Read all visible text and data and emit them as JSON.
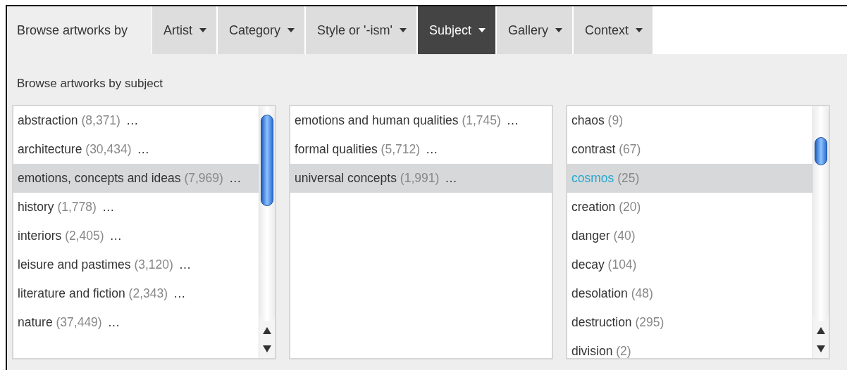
{
  "nav": {
    "label": "Browse artworks by",
    "tabs": [
      {
        "label": "Artist",
        "selected": false
      },
      {
        "label": "Category",
        "selected": false
      },
      {
        "label": "Style or '-ism'",
        "selected": false
      },
      {
        "label": "Subject",
        "selected": true
      },
      {
        "label": "Gallery",
        "selected": false
      },
      {
        "label": "Context",
        "selected": false
      }
    ]
  },
  "heading": "Browse artworks by subject",
  "lists": [
    {
      "items": [
        {
          "name": "abstraction",
          "count": "(8,371)",
          "more": "…",
          "selected": false
        },
        {
          "name": "architecture",
          "count": "(30,434)",
          "more": "…",
          "selected": false
        },
        {
          "name": "emotions, concepts and ideas",
          "count": "(7,969)",
          "more": "…",
          "selected": true
        },
        {
          "name": "history",
          "count": "(1,778)",
          "more": "…",
          "selected": false
        },
        {
          "name": "interiors",
          "count": "(2,405)",
          "more": "…",
          "selected": false
        },
        {
          "name": "leisure and pastimes",
          "count": "(3,120)",
          "more": "…",
          "selected": false
        },
        {
          "name": "literature and fiction",
          "count": "(2,343)",
          "more": "…",
          "selected": false
        },
        {
          "name": "nature",
          "count": "(37,449)",
          "more": "…",
          "selected": false
        }
      ]
    },
    {
      "items": [
        {
          "name": "emotions and human qualities",
          "count": "(1,745)",
          "more": "…",
          "selected": false
        },
        {
          "name": "formal qualities",
          "count": "(5,712)",
          "more": "…",
          "selected": false
        },
        {
          "name": "universal concepts",
          "count": "(1,991)",
          "more": "…",
          "selected": true
        }
      ]
    },
    {
      "items": [
        {
          "name": "chaos",
          "count": "(9)",
          "selected": false,
          "current": false
        },
        {
          "name": "contrast",
          "count": "(67)",
          "selected": false,
          "current": false
        },
        {
          "name": "cosmos",
          "count": "(25)",
          "selected": true,
          "current": true
        },
        {
          "name": "creation",
          "count": "(20)",
          "selected": false,
          "current": false
        },
        {
          "name": "danger",
          "count": "(40)",
          "selected": false,
          "current": false
        },
        {
          "name": "decay",
          "count": "(104)",
          "selected": false,
          "current": false
        },
        {
          "name": "desolation",
          "count": "(48)",
          "selected": false,
          "current": false
        },
        {
          "name": "destruction",
          "count": "(295)",
          "selected": false,
          "current": false
        },
        {
          "name": "division",
          "count": "(2)",
          "selected": false,
          "current": false
        }
      ]
    }
  ]
}
